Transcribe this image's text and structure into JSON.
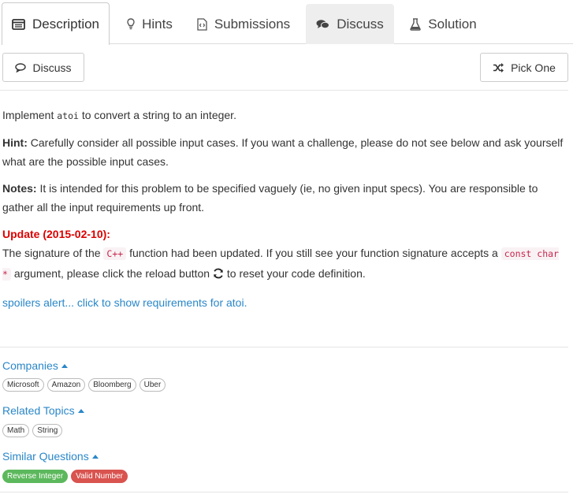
{
  "tabs": {
    "description": "Description",
    "hints": "Hints",
    "submissions": "Submissions",
    "discuss": "Discuss",
    "solution": "Solution"
  },
  "toolbar": {
    "discuss_label": "Discuss",
    "pick_one_label": "Pick One"
  },
  "problem": {
    "p1_pre": "Implement ",
    "p1_code": "atoi",
    "p1_post": " to convert a string to an integer.",
    "hint_label": "Hint:",
    "hint_text": " Carefully consider all possible input cases. If you want a challenge, please do not see below and ask yourself what are the possible input cases.",
    "notes_label": "Notes:",
    "notes_text": " It is intended for this problem to be specified vaguely (ie, no given input specs). You are responsible to gather all the input requirements up front.",
    "update_label": "Update (2015-02-10):",
    "update_pre": "The signature of the ",
    "update_code1": "C++",
    "update_mid": " function had been updated. If you still see your function signature accepts a ",
    "update_code2": "const char *",
    "update_post": " argument, please click the reload button ",
    "update_end": " to reset your code definition.",
    "spoiler": "spoilers alert... click to show requirements for atoi."
  },
  "companies": {
    "title": "Companies",
    "tags": [
      "Microsoft",
      "Amazon",
      "Bloomberg",
      "Uber"
    ]
  },
  "related_topics": {
    "title": "Related Topics",
    "tags": [
      "Math",
      "String"
    ]
  },
  "similar_questions": {
    "title": "Similar Questions",
    "tags": [
      {
        "label": "Reverse Integer",
        "difficulty_color": "#5cb85c"
      },
      {
        "label": "Valid Number",
        "difficulty_color": "#d9534f"
      }
    ]
  },
  "colors": {
    "link": "#2a87c8",
    "update": "#dd0000",
    "code": "#c7254e"
  }
}
